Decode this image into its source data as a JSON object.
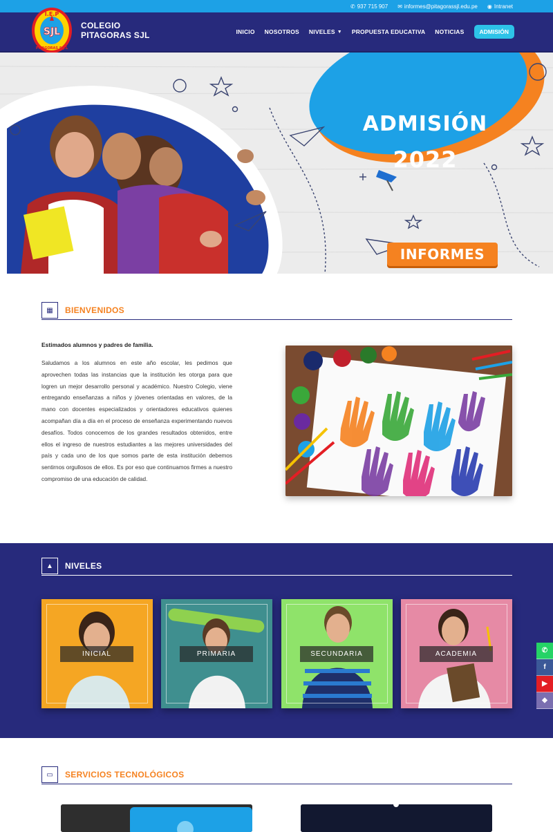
{
  "topbar": {
    "phone": "937 715 907",
    "email": "informes@pitagorassjl.edu.pe",
    "intranet": "Intranet"
  },
  "brand": {
    "line1": "COLEGIO",
    "line2": "PITAGORAS SJL",
    "logo_text_top": "I.E.P",
    "logo_text_mid": "SJL",
    "logo_text_bottom": "PITAGORAS S.J.L"
  },
  "nav": {
    "items": [
      "INICIO",
      "NOSOTROS",
      "NIVELES",
      "PROPUESTA EDUCATIVA",
      "NOTICIAS"
    ],
    "cta": "ADMISIÓN"
  },
  "hero": {
    "title": "ADMISIÓN",
    "year": "2022",
    "button": "INFORMES"
  },
  "welcome": {
    "title": "BIENVENIDOS",
    "lead": "Estimados alumnos y padres de familia.",
    "body": "Saludamos a los alumnos en este año escolar, les pedimos que aprovechen todas las instancias que la institución les otorga para que logren un mejor desarrollo personal y académico. Nuestro Colegio, viene entregando enseñanzas a niños y jóvenes orientadas en valores, de la mano con docentes especializados y orientadores educativos quienes acompañan día a día en el proceso de enseñanza experimentando nuevos desafíos. Todos conocemos de los grandes resultados obtenidos, entre ellos el ingreso de nuestros estudiantes a las mejores universidades del país y cada uno de los que somos parte de esta institución debemos sentirnos orgullosos de ellos. Es por eso que continuamos firmes a nuestro compromiso de una educación de calidad."
  },
  "niveles": {
    "title": "NIVELES",
    "cards": [
      {
        "label": "INICIAL",
        "color": "#f5a623"
      },
      {
        "label": "PRIMARIA",
        "color": "#3f8f8f"
      },
      {
        "label": "SECUNDARIA",
        "color": "#8fe36a"
      },
      {
        "label": "ACADEMIA",
        "color": "#e68aa5"
      }
    ]
  },
  "servicios": {
    "title": "SERVICIOS TECNOLÓGICOS"
  },
  "social": [
    "whatsapp-icon",
    "facebook-icon",
    "youtube-icon",
    "app-icon"
  ],
  "colors": {
    "primary": "#272a7c",
    "accent": "#f58220",
    "topbar": "#1da1e6",
    "cta": "#2dc3e8"
  }
}
